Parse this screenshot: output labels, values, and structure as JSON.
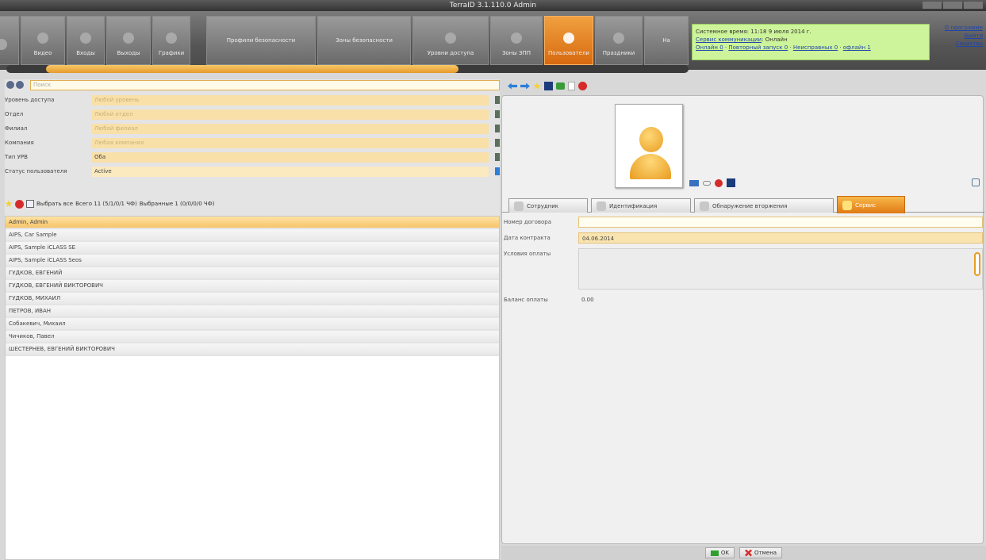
{
  "window": {
    "title": "TerraID 3.1.110.0 Admin"
  },
  "ribbon": {
    "tabs": [
      {
        "label": "",
        "icon": "camera-icon"
      },
      {
        "label": "Видео",
        "icon": "video-icon"
      },
      {
        "label": "Входы",
        "icon": "entry-icon"
      },
      {
        "label": "Выходы",
        "icon": "exit-icon"
      },
      {
        "label": "Графики",
        "icon": "calendar-icon"
      },
      {
        "label": "Профили безопасности",
        "icon": ""
      },
      {
        "label": "Зоны безопасности",
        "icon": ""
      },
      {
        "label": "Уровни доступа",
        "icon": "access-level-icon"
      },
      {
        "label": "Зоны ЗПП",
        "icon": "zone-icon"
      },
      {
        "label": "Пользователи",
        "icon": "users-icon"
      },
      {
        "label": "Праздники",
        "icon": "holidays-icon"
      },
      {
        "label": "На",
        "icon": ""
      }
    ],
    "active_tab": "Пользователи"
  },
  "status": {
    "line1": "Системное время: 11:18 9 июля 2014 г.",
    "line2_link": "Сервис коммуникации",
    "line2_value": ": Онлайн",
    "line3": [
      {
        "text": "Онлайн 0"
      },
      {
        "text": "Повторный запуск 0"
      },
      {
        "text": "Неисправных 0"
      },
      {
        "text": "офлайн 1"
      }
    ]
  },
  "right_links": [
    "О программе",
    "Выйти",
    "Свойства"
  ],
  "left": {
    "search_placeholder": "Поиск",
    "filters": [
      {
        "label": "Уровень доступа",
        "value": "Любой уровень",
        "muted": true
      },
      {
        "label": "Отдел",
        "value": "Любой отдел",
        "muted": true
      },
      {
        "label": "Филиал",
        "value": "Любой филиал",
        "muted": true
      },
      {
        "label": "Компания",
        "value": "Любая компания",
        "muted": true
      },
      {
        "label": "Тип УРВ",
        "value": "Оба",
        "muted": false
      },
      {
        "label": "Статус пользователя",
        "value": "Active",
        "muted": false
      }
    ],
    "toolbar": {
      "select_all": "Выбрать все",
      "total": "Всего 11 (5",
      "total_tail": "/1",
      "total_tail2": "/0",
      "total_tail3": "/1 ЧФ)",
      "selected": "Выбранные 1 (0",
      "selected_tail": "/0",
      "selected_tail2": "/0",
      "selected_tail3": "/0 ЧФ)"
    },
    "users": [
      "Admin, Admin",
      "AIPS, Car Sample",
      "AIPS, Sample iCLASS SE",
      "AIPS, Sample iCLASS Seos",
      "ГУДКОВ, ЕВГЕНИЙ",
      "ГУДКОВ, ЕВГЕНИЙ ВИКТОРОВИЧ",
      "ГУДКОВ, МИХАИЛ",
      "ПЕТРОВ, ИВАН",
      "Собакевич, Михаил",
      "Чичиков, Павел",
      "ШЕСТЕРНЕВ, ЕВГЕНИЙ ВИКТОРОВИЧ"
    ],
    "selected_index": 0
  },
  "right": {
    "tabs": [
      {
        "label": "Сотрудник"
      },
      {
        "label": "Идентификация"
      },
      {
        "label": "Обнаружение вторжения"
      },
      {
        "label": "Сервис"
      }
    ],
    "active_tab": "Сервис",
    "fields": {
      "contract_number_label": "Номер договора",
      "contract_number_value": "",
      "contract_date_label": "Дата контракта",
      "contract_date_value": "04.06.2014",
      "payment_terms_label": "Условия оплаты",
      "payment_terms_value": "",
      "payment_balance_label": "Баланс оплаты",
      "payment_balance_value": "0.00"
    },
    "buttons": {
      "ok": "OK",
      "cancel": "Отмена"
    }
  },
  "colors": {
    "accent": "#e8891c",
    "status_bg": "#cdf49a",
    "selected_row": "#f7c56a",
    "field_bg": "#f9e0a8"
  }
}
